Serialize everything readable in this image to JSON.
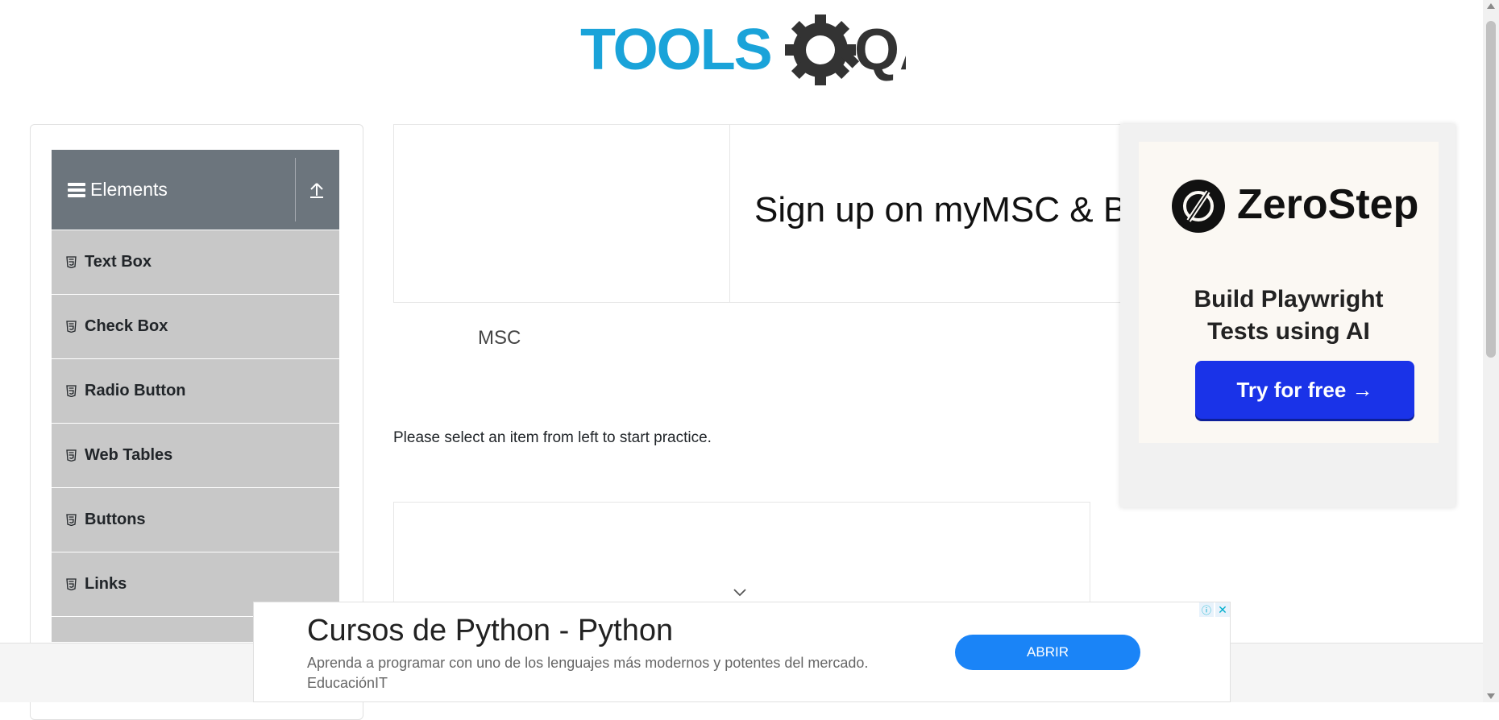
{
  "header": {
    "logo_text_primary": "TOOLS",
    "logo_text_secondary": "QA"
  },
  "sidebar": {
    "group_title": "Elements",
    "items": [
      {
        "label": "Text Box"
      },
      {
        "label": "Check Box"
      },
      {
        "label": "Radio Button"
      },
      {
        "label": "Web Tables"
      },
      {
        "label": "Buttons"
      },
      {
        "label": "Links"
      }
    ]
  },
  "main": {
    "promo_title": "Sign up on myMSC & B",
    "promo_brand": "MSC",
    "instruction": "Please select an item from left to start practice."
  },
  "ad_right": {
    "brand": "ZeroStep",
    "tagline_line1": "Build Playwright",
    "tagline_line2": "Tests using AI",
    "cta": "Try for free →"
  },
  "ad_bottom": {
    "headline": "Cursos de Python - Python",
    "description": "Aprenda a programar con uno de los lenguajes más modernos y potentes del mercado. EducaciónIT",
    "button": "ABRIR",
    "info_icon": "ⓘ",
    "close_icon": "✕"
  },
  "colors": {
    "logo_blue": "#1aa3d9",
    "logo_dark": "#333333",
    "sidebar_header": "#6c757d",
    "sidebar_item": "#c8c8c8",
    "ad_cta": "#1a33e8",
    "ad_open": "#1a84f7"
  }
}
